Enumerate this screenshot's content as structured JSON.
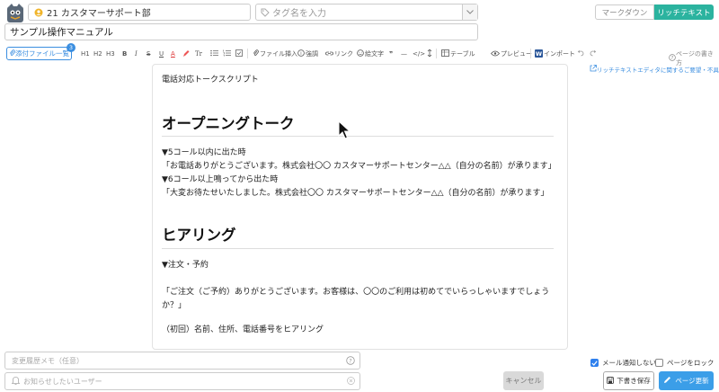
{
  "header": {
    "group_name": "21 カスタマーサポート部",
    "tag_placeholder": "タグ名を入力",
    "mode_markdown": "マークダウン",
    "mode_richtext": "リッチテキスト"
  },
  "title": "サンプル操作マニュアル",
  "toolbar": {
    "attach_label": "添付ファイル一覧",
    "attach_count": "3",
    "h1": "H1",
    "h2": "H2",
    "h3": "H3",
    "bold": "B",
    "italic": "I",
    "strike": "S",
    "underline": "U",
    "color": "A",
    "clear_format": "Tr",
    "file_insert": "ファイル挿入",
    "emphasis": "強調",
    "link": "リンク",
    "emoji": "絵文字",
    "quote": "❞",
    "hr": "—",
    "code": "</>",
    "table": "テーブル",
    "preview": "プレビュー",
    "import": "インポート",
    "howto": "ページの書き方",
    "feedback": "リッチテキストエディタに関するご要望・不具合"
  },
  "editor": {
    "intro": "電話対応トークスクリプト",
    "h_opening": "オープニングトーク",
    "line1": "▼5コール以内に出た時",
    "line2": "「お電話ありがとうございます。株式会社〇〇 カスタマーサポートセンター△△（自分の名前）が承ります」",
    "line3": "▼6コール以上鳴ってから出た時",
    "line4": "「大変お待たせいたしました。株式会社〇〇 カスタマーサポートセンター△△（自分の名前）が承ります」",
    "h_hearing": "ヒアリング",
    "line5": "▼注文・予約",
    "line6": "「ご注文（ご予約）ありがとうございます。お客様は、〇〇のご利用は初めてでいらっしゃいますでしょう",
    "line7": "か？」",
    "line8": "（初回）名前、住所、電話番号をヒアリング"
  },
  "footer": {
    "memo_placeholder": "変更履歴メモ（任意）",
    "notify_placeholder": "お知らせしたいユーザー",
    "cancel": "キャンセル",
    "no_mail": "メール通知しない",
    "lock_page": "ページをロック",
    "save_draft": "下書き保存",
    "update_page": "ページ更新"
  }
}
